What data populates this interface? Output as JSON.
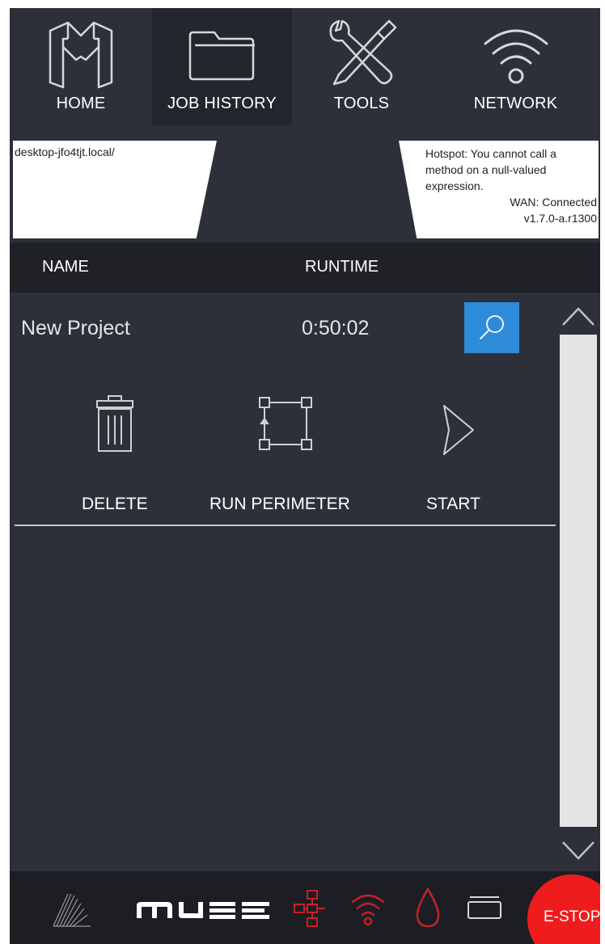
{
  "nav": {
    "tabs": [
      {
        "label": "HOME",
        "icon": "home-icon"
      },
      {
        "label": "JOB HISTORY",
        "icon": "folder-icon",
        "active": true
      },
      {
        "label": "TOOLS",
        "icon": "tools-icon"
      },
      {
        "label": "NETWORK",
        "icon": "wifi-icon"
      }
    ]
  },
  "status": {
    "host": "desktop-jfo4tjt.local/",
    "hotspot_lines": [
      "Hotspot: You cannot call a",
      "method on a null-valued",
      "expression."
    ],
    "wan": "WAN: Connected",
    "version": "v1.7.0-a.r1300"
  },
  "table": {
    "headers": {
      "name": "NAME",
      "runtime": "RUNTIME"
    },
    "rows": [
      {
        "name": "New Project",
        "runtime": "0:50:02"
      }
    ]
  },
  "actions": {
    "delete": "DELETE",
    "run_perimeter": "RUN PERIMETER",
    "start": "START"
  },
  "bottom": {
    "brand": "muse",
    "estop": "E-STOP"
  },
  "colors": {
    "background": "#2d3039",
    "accent_blue": "#2e8bd9",
    "estop_red": "#ee1c1c",
    "alert_red": "#c8202a"
  }
}
